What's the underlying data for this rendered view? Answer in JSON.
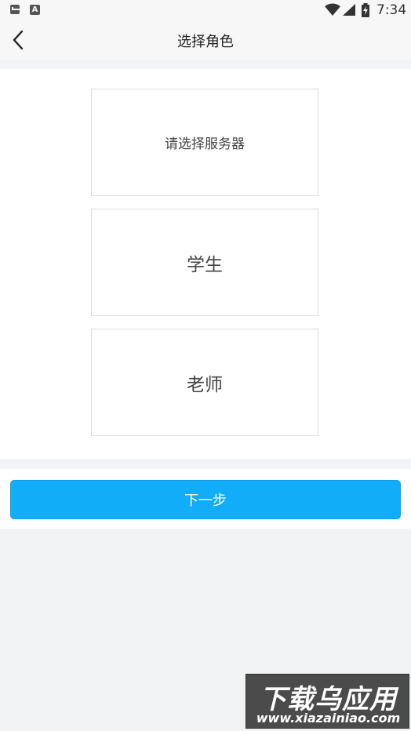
{
  "status_bar": {
    "time": "7:34",
    "icons": [
      "mail-notification-icon",
      "a-notification-icon",
      "wifi-icon",
      "cell-signal-icon",
      "battery-charging-icon"
    ]
  },
  "header": {
    "title": "选择角色",
    "back_icon": "chevron-left-icon"
  },
  "options": {
    "server": "请选择服务器",
    "student": "学生",
    "teacher": "老师"
  },
  "actions": {
    "next_label": "下一步"
  },
  "watermark": {
    "line1": "下载乌应用",
    "line2": "www.xiazainiao.com"
  },
  "colors": {
    "accent": "#12adf8",
    "background": "#f2f3f5",
    "bar": "#f7f7f7"
  }
}
